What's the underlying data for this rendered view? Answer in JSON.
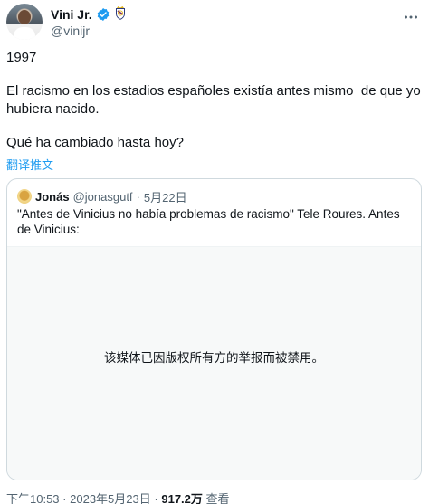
{
  "author": {
    "name": "Vini Jr.",
    "handle": "@vinijr",
    "verified_color": "#1d9bf0"
  },
  "tweet": {
    "lines": [
      "1997",
      "El racismo en los estadios españoles existía antes mismo  de que yo hubiera nacido.",
      "Qué ha cambiado hasta hoy?"
    ],
    "translate_label": "翻译推文"
  },
  "quote": {
    "name": "Jonás",
    "handle": "@jonasgutf",
    "separator": "·",
    "date": "5月22日",
    "text": "\"Antes de Vinicius no había problemas de racismo\" Tele Roures. Antes de Vinicius:",
    "media_notice": "该媒体已因版权所有方的举报而被禁用。"
  },
  "meta": {
    "time": "下午10:53",
    "separator1": "·",
    "date": "2023年5月23日",
    "separator2": "·",
    "views_count": "917.2万",
    "views_label": "查看"
  },
  "colors": {
    "link": "#1d9bf0",
    "secondary_text": "#536471",
    "border": "#cfd9de",
    "media_bg": "#f7f9f9"
  },
  "icons": [
    "verified-badge-icon",
    "real-madrid-crest-icon",
    "more-options-icon"
  ]
}
